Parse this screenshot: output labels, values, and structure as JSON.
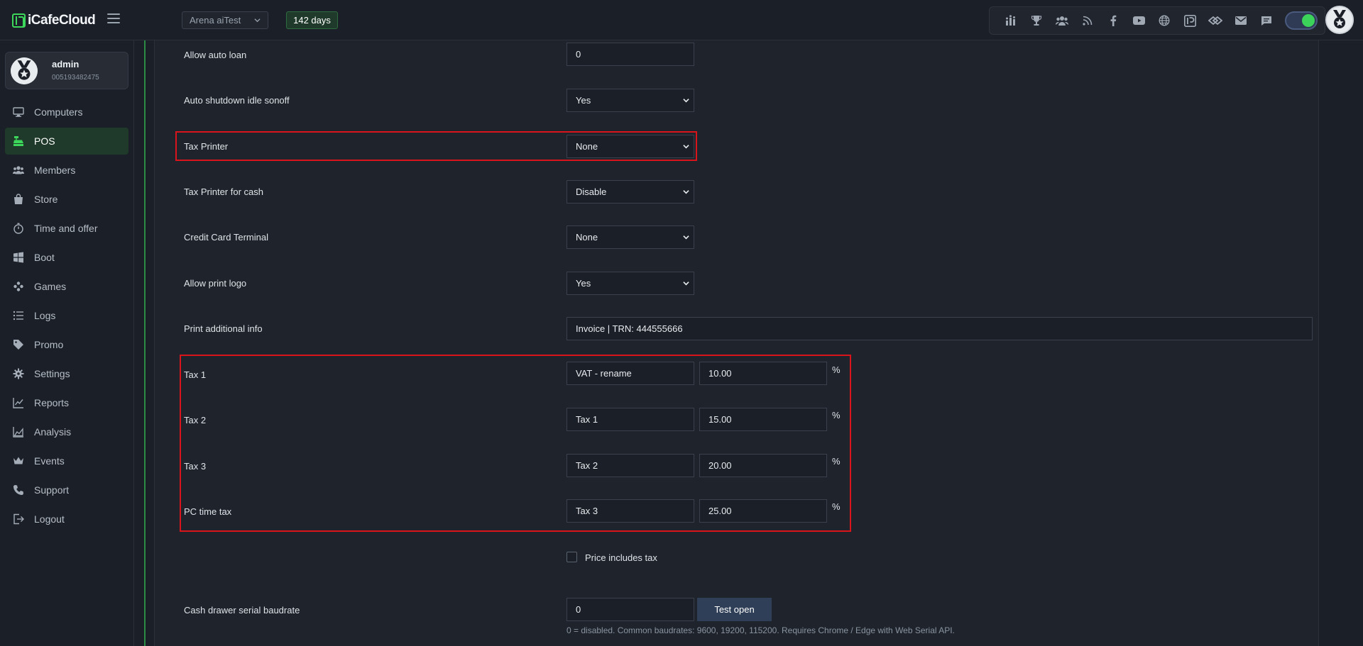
{
  "app": {
    "logo_text": "iCafeCloud"
  },
  "header": {
    "cafe_select": "Arena aiTest",
    "days_badge": "142 days"
  },
  "user": {
    "name": "admin",
    "id": "005193482475"
  },
  "sidebar": {
    "items": [
      {
        "label": "Computers",
        "icon": "monitor-icon"
      },
      {
        "label": "POS",
        "icon": "cash-register-icon",
        "active": true
      },
      {
        "label": "Members",
        "icon": "users-icon"
      },
      {
        "label": "Store",
        "icon": "shopping-bag-icon"
      },
      {
        "label": "Time and offer",
        "icon": "stopwatch-icon"
      },
      {
        "label": "Boot",
        "icon": "windows-icon"
      },
      {
        "label": "Games",
        "icon": "gamepad-icon"
      },
      {
        "label": "Logs",
        "icon": "list-icon"
      },
      {
        "label": "Promo",
        "icon": "tag-icon"
      },
      {
        "label": "Settings",
        "icon": "gear-icon"
      },
      {
        "label": "Reports",
        "icon": "line-chart-icon"
      },
      {
        "label": "Analysis",
        "icon": "area-chart-icon"
      },
      {
        "label": "Events",
        "icon": "crown-icon"
      },
      {
        "label": "Support",
        "icon": "phone-icon"
      },
      {
        "label": "Logout",
        "icon": "logout-icon"
      }
    ]
  },
  "form": {
    "allow_auto_loan": {
      "label": "Allow auto loan",
      "value": "0"
    },
    "auto_shutdown": {
      "label": "Auto shutdown idle sonoff",
      "value": "Yes"
    },
    "tax_printer": {
      "label": "Tax Printer",
      "value": "None"
    },
    "tax_printer_cash": {
      "label": "Tax Printer for cash",
      "value": "Disable"
    },
    "credit_card_terminal": {
      "label": "Credit Card Terminal",
      "value": "None"
    },
    "allow_print_logo": {
      "label": "Allow print logo",
      "value": "Yes"
    },
    "print_additional_info": {
      "label": "Print additional info",
      "value": "Invoice  |  TRN: 444555666"
    },
    "taxes": [
      {
        "label": "Tax 1",
        "name": "VAT - rename",
        "rate": "10.00",
        "unit": "%"
      },
      {
        "label": "Tax 2",
        "name": "Tax 1",
        "rate": "15.00",
        "unit": "%"
      },
      {
        "label": "Tax 3",
        "name": "Tax 2",
        "rate": "20.00",
        "unit": "%"
      },
      {
        "label": "PC time tax",
        "name": "Tax 3",
        "rate": "25.00",
        "unit": "%"
      }
    ],
    "price_includes_tax": {
      "label": "Price includes tax",
      "checked": false
    },
    "cash_drawer": {
      "label": "Cash drawer serial baudrate",
      "value": "0",
      "button": "Test open",
      "hint": "0 = disabled. Common baudrates: 9600, 19200, 115200. Requires Chrome / Edge with Web Serial API."
    }
  },
  "colors": {
    "accent_green": "#3dd75c",
    "highlight_red": "#d9141b",
    "background": "#1b1f27"
  }
}
